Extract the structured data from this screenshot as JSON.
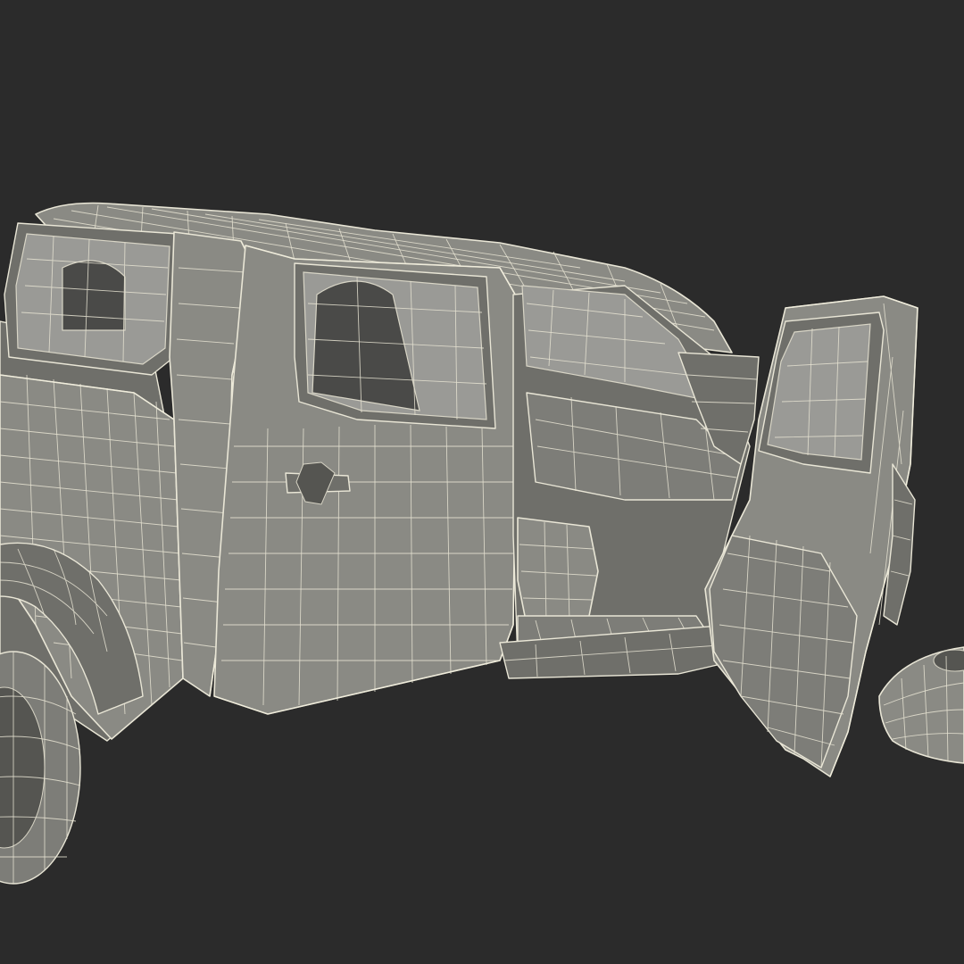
{
  "scene": {
    "subject": "wireframe-pickup-truck-model",
    "render_style": "gray-clay-with-white-wireframe",
    "colors": {
      "background": "#2b2b2b",
      "body": "#8a8a84",
      "body_dark": "#6f6f6a",
      "wireframe": "#e9e6d6",
      "glass": "#4a4a48"
    }
  }
}
